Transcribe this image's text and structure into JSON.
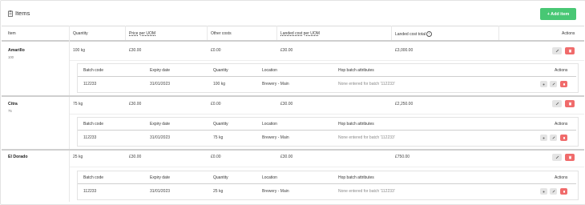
{
  "header": {
    "title": "Items",
    "add_button": "+ Add item"
  },
  "columns": {
    "item": "Item",
    "quantity": "Quantity",
    "price": "Price per UOM",
    "other_costs": "Other costs",
    "landed_cost": "Landed cost per UOM",
    "landed_total": "Landed cost total",
    "actions": "Actions"
  },
  "batch_columns": {
    "batch_code": "Batch code",
    "expiry": "Expiry date",
    "quantity": "Quantity",
    "location": "Location",
    "hop_attr": "Hop batch attributes",
    "actions": "Actions"
  },
  "items": [
    {
      "name": "Amarillo",
      "sub": "100",
      "quantity": "100 kg",
      "price": "£30.00",
      "other": "£0.00",
      "landed": "£30.00",
      "total": "£3,000.00",
      "batch": {
        "code": "112233",
        "expiry": "31/01/2023",
        "quantity": "100 kg",
        "location": "Brewery - Main",
        "attr": "None entered for batch '112233'"
      }
    },
    {
      "name": "Citra",
      "sub": "75",
      "quantity": "75 kg",
      "price": "£30.00",
      "other": "£0.00",
      "landed": "£30.00",
      "total": "£2,250.00",
      "batch": {
        "code": "112233",
        "expiry": "31/01/2023",
        "quantity": "75 kg",
        "location": "Brewery - Main",
        "attr": "None entered for batch '112233'"
      }
    },
    {
      "name": "El Dorado",
      "sub": "",
      "quantity": "25 kg",
      "price": "£30.00",
      "other": "£0.00",
      "landed": "£30.00",
      "total": "£750.00",
      "batch": {
        "code": "112233",
        "expiry": "31/01/2023",
        "quantity": "25 kg",
        "location": "Brewery - Main",
        "attr": "None entered for batch '112233'"
      }
    }
  ],
  "colors": {
    "primary": "#48c774",
    "danger": "#f06b6b",
    "border": "#dbdbdb"
  },
  "icons": {
    "title": "clipboard-icon",
    "edit": "pencil-icon",
    "delete": "trash-icon",
    "info": "info-icon",
    "view": "dot-icon"
  }
}
